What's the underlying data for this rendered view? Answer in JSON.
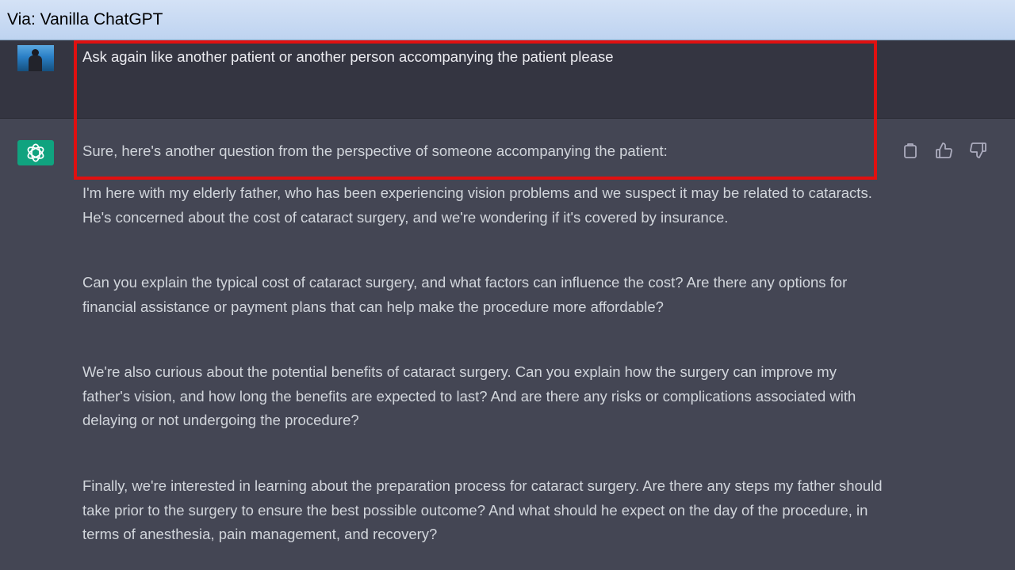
{
  "caption": {
    "text": "Via: Vanilla ChatGPT"
  },
  "user_message": {
    "text": "Ask again like another patient or another person accompanying the patient please"
  },
  "assistant_message": {
    "paragraphs": [
      "Sure, here's another question from the perspective of someone accompanying the patient:",
      "I'm here with my elderly father, who has been experiencing vision problems and we suspect it may be related to cataracts. He's concerned about the cost of cataract surgery, and we're wondering if it's covered by insurance.",
      "Can you explain the typical cost of cataract surgery, and what factors can influence the cost? Are there any options for financial assistance or payment plans that can help make the procedure more affordable?",
      "We're also curious about the potential benefits of cataract surgery. Can you explain how the surgery can improve my father's vision, and how long the benefits are expected to last? And are there any risks or complications associated with delaying or not undergoing the procedure?",
      "Finally, we're interested in learning about the preparation process for cataract surgery. Are there any steps my father should take prior to the surgery to ensure the best possible outcome? And what should he expect on the day of the procedure, in terms of anesthesia, pain management, and recovery?"
    ]
  },
  "icons": {
    "avatar": "user-avatar-photo",
    "assistant": "openai-logo-icon",
    "actions": [
      "copy-icon",
      "thumbs-up-icon",
      "thumbs-down-icon"
    ]
  },
  "colors": {
    "user_bg": "#343541",
    "assistant_bg": "#444654",
    "brand": "#10a37f",
    "highlight": "#e01010"
  }
}
